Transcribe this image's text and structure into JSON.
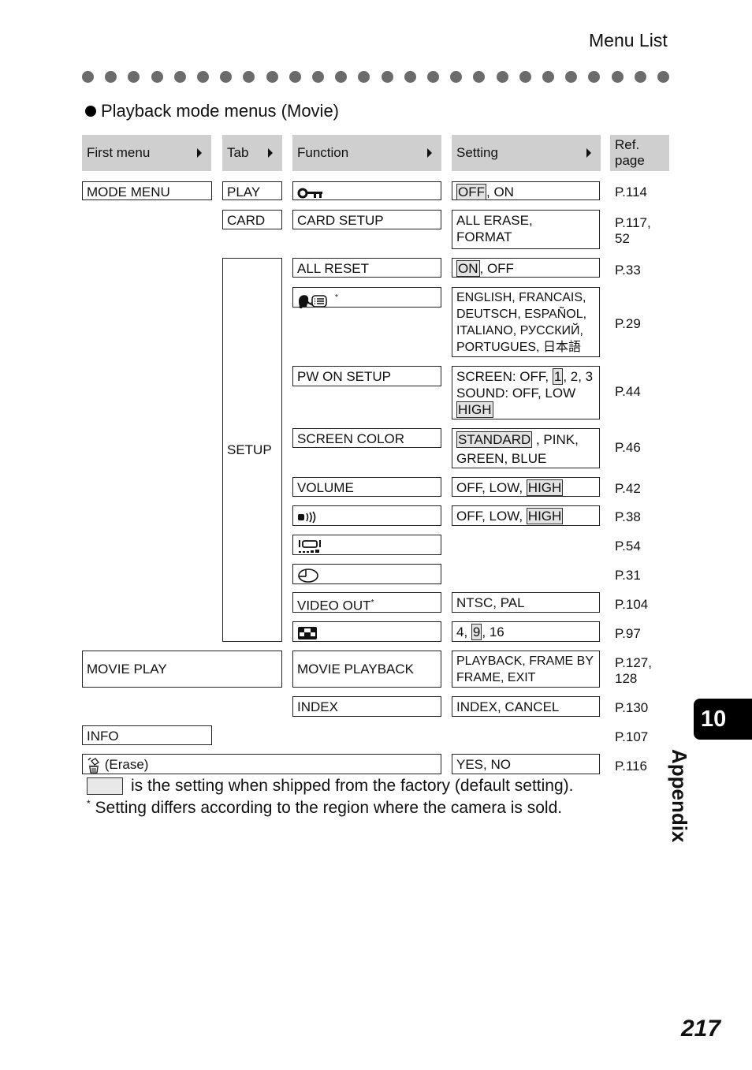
{
  "header": {
    "title": "Menu List"
  },
  "section": {
    "title": "Playback mode menus (Movie)"
  },
  "table": {
    "columns": [
      "First menu",
      "Tab",
      "Function",
      "Setting",
      "Ref. page"
    ],
    "ref_header_line1": "Ref.",
    "ref_header_line2": "page",
    "first_menu": {
      "mode_menu": "MODE MENU",
      "movie_play": "MOVIE PLAY",
      "info": "INFO",
      "erase": "(Erase)"
    },
    "tabs": {
      "play": "PLAY",
      "card": "CARD",
      "setup": "SETUP"
    },
    "rows": {
      "protect": {
        "function_icon": "key-icon",
        "setting_default": "OFF",
        "setting_rest": ", ON",
        "ref": "P.114"
      },
      "card_setup": {
        "function": "CARD SETUP",
        "setting_line1": "ALL ERASE,",
        "setting_line2": "FORMAT",
        "ref_line1": "P.117,",
        "ref_line2": "52"
      },
      "all_reset": {
        "function": "ALL RESET",
        "setting_default": "ON",
        "setting_rest": ", OFF",
        "ref": "P.33"
      },
      "language": {
        "function_icon": "language-icon",
        "function_suffix": "*",
        "setting_lines": [
          "ENGLISH, FRANCAIS,",
          "DEUTSCH, ESPAÑOL,",
          "ITALIANO, РУССКИЙ,",
          "PORTUGUES, 日本語"
        ],
        "ref": "P.29"
      },
      "pw_on_setup": {
        "function": "PW ON SETUP",
        "setting_line1_pre": "SCREEN: OFF, ",
        "setting_line1_default": "1",
        "setting_line1_post": ", 2, 3",
        "setting_line2": "SOUND: OFF, LOW",
        "setting_line3_default": "HIGH",
        "ref": "P.44"
      },
      "screen_color": {
        "function": "SCREEN COLOR",
        "setting_default": "STANDARD",
        "setting_rest": " , PINK,",
        "setting_line2": "GREEN, BLUE",
        "ref": "P.46"
      },
      "volume": {
        "function": "VOLUME",
        "setting_pre": "OFF, LOW, ",
        "setting_default": "HIGH",
        "ref": "P.42"
      },
      "beep": {
        "function_icon": "sound-icon",
        "setting_pre": "OFF, LOW, ",
        "setting_default": "HIGH",
        "ref": "P.38"
      },
      "monitor": {
        "function_icon": "monitor-brightness-icon",
        "ref": "P.54"
      },
      "clock": {
        "function_icon": "clock-icon",
        "ref": "P.31"
      },
      "video_out": {
        "function": "VIDEO OUT",
        "function_suffix": "*",
        "setting": "NTSC, PAL",
        "ref": "P.104"
      },
      "index_display": {
        "function_icon": "grid-icon",
        "setting_pre": "4, ",
        "setting_default": "9",
        "setting_post": ", 16",
        "ref": "P.97"
      },
      "movie_playback": {
        "function": "MOVIE PLAYBACK",
        "setting_line1": "PLAYBACK, FRAME BY",
        "setting_line2": "FRAME, EXIT",
        "ref_line1": "P.127,",
        "ref_line2": "128"
      },
      "index": {
        "function": "INDEX",
        "setting": "INDEX, CANCEL",
        "ref": "P.130"
      },
      "info": {
        "ref": "P.107"
      },
      "erase": {
        "icon": "trash-icon",
        "setting": "YES, NO",
        "ref": "P.116"
      }
    }
  },
  "footnotes": {
    "default_legend": "is the setting when shipped from the factory (default setting).",
    "region_mark": "*",
    "region_note": " Setting differs according to the region where the camera is sold."
  },
  "chapter": {
    "number": "10",
    "label": "Appendix"
  },
  "page": {
    "number": "217"
  },
  "colors": {
    "header_fill": "#cfcfcf",
    "default_highlight": "#e2e2e2",
    "dot_color": "#6b6b6b",
    "chapter_tab": "#000000"
  }
}
